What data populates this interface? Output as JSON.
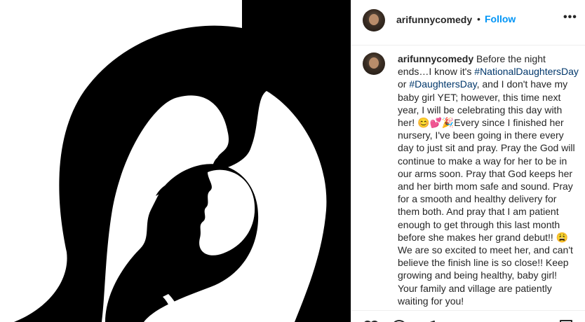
{
  "header": {
    "username": "arifunnycomedy",
    "separator": "•",
    "follow_label": "Follow",
    "more_label": "•••"
  },
  "caption": {
    "username": "arifunnycomedy",
    "text_1": " Before the night ends…I know it's ",
    "hashtag_1": "#NationalDaughtersDay",
    "text_2": " or ",
    "hashtag_2": "#DaughtersDay",
    "text_3": ", and I don't have my baby girl YET; however, this time next year, I will be celebrating this day with her! 😊💕🎉Every since I finished her nursery, I've been going in there every day to just sit and pray. Pray the God will continue to make a way for her to be in our arms soon. Pray that God keeps her and her birth mom safe and sound. Pray for a smooth and healthy delivery for them both. And pray that I am patient enough to get through this last month before she makes her grand debut!! 😩We are so excited to meet her, and can't believe the finish line is so close!! Keep growing and being healthy, baby girl! Your family and village are patiently waiting for you!"
  },
  "icons": {
    "like": "heart-icon",
    "comment": "comment-icon",
    "share": "share-icon",
    "save": "bookmark-icon"
  },
  "colors": {
    "follow": "#0095f6",
    "hashtag": "#00376b",
    "text": "#262626",
    "divider": "#efefef"
  }
}
